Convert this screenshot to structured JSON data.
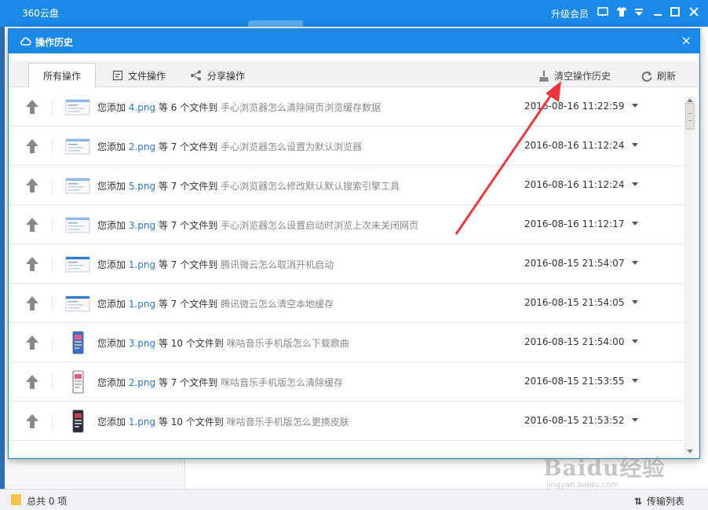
{
  "app": {
    "title": "360云盘",
    "vip_label": "升级会员",
    "status_total": "总共 0 项",
    "transfer_label": "传输列表"
  },
  "dialog": {
    "title": "操作历史",
    "close_glyph": "×"
  },
  "toolbar": {
    "tabs": [
      {
        "label": "所有操作",
        "active": true
      },
      {
        "label": "文件操作",
        "active": false
      },
      {
        "label": "分享操作",
        "active": false
      }
    ],
    "clear_history": "清空操作历史",
    "refresh": "刷新"
  },
  "rows": [
    {
      "prefix": "您添加",
      "file": "4.png",
      "count_text": "等 6 个文件到",
      "folder": "手心浏览器怎么清除网页浏览缓存数据",
      "time": "2016-08-16 11:22:59",
      "thumb": "landscape"
    },
    {
      "prefix": "您添加",
      "file": "2.png",
      "count_text": "等 7 个文件到",
      "folder": "手心浏览器怎么设置为默认浏览器",
      "time": "2016-08-16 11:12:24",
      "thumb": "landscape"
    },
    {
      "prefix": "您添加",
      "file": "5.png",
      "count_text": "等 7 个文件到",
      "folder": "手心浏览器怎么修改默认默认搜索引擎工具",
      "time": "2016-08-16 11:12:24",
      "thumb": "landscape"
    },
    {
      "prefix": "您添加",
      "file": "3.png",
      "count_text": "等 7 个文件到",
      "folder": "手心浏览器怎么设置启动时浏览上次未关闭网页",
      "time": "2016-08-16 11:12:17",
      "thumb": "landscape"
    },
    {
      "prefix": "您添加",
      "file": "1.png",
      "count_text": "等 7 个文件到",
      "folder": "腾讯微云怎么取消开机启动",
      "time": "2016-08-15 21:54:07",
      "thumb": "landscape-blue"
    },
    {
      "prefix": "您添加",
      "file": "1.png",
      "count_text": "等 7 个文件到",
      "folder": "腾讯微云怎么清空本地缓存",
      "time": "2016-08-15 21:54:05",
      "thumb": "landscape-blue"
    },
    {
      "prefix": "您添加",
      "file": "3.png",
      "count_text": "等 10 个文件到",
      "folder": "咪咕音乐手机版怎么下载歌曲",
      "time": "2016-08-15 21:54:00",
      "thumb": "portrait"
    },
    {
      "prefix": "您添加",
      "file": "2.png",
      "count_text": "等 7 个文件到",
      "folder": "咪咕音乐手机版怎么清除缓存",
      "time": "2016-08-15 21:53:55",
      "thumb": "portrait-light"
    },
    {
      "prefix": "您添加",
      "file": "1.png",
      "count_text": "等 10 个文件到",
      "folder": "咪咕音乐手机版怎么更换皮肤",
      "time": "2016-08-15 21:53:52",
      "thumb": "portrait-dark"
    }
  ],
  "watermark": {
    "logo": "Baidu经验",
    "url": "jingyan.baidu.com"
  },
  "colors": {
    "accent": "#1a8ae6",
    "file_link": "#2b78c2",
    "annotation_arrow": "#e8383d"
  }
}
